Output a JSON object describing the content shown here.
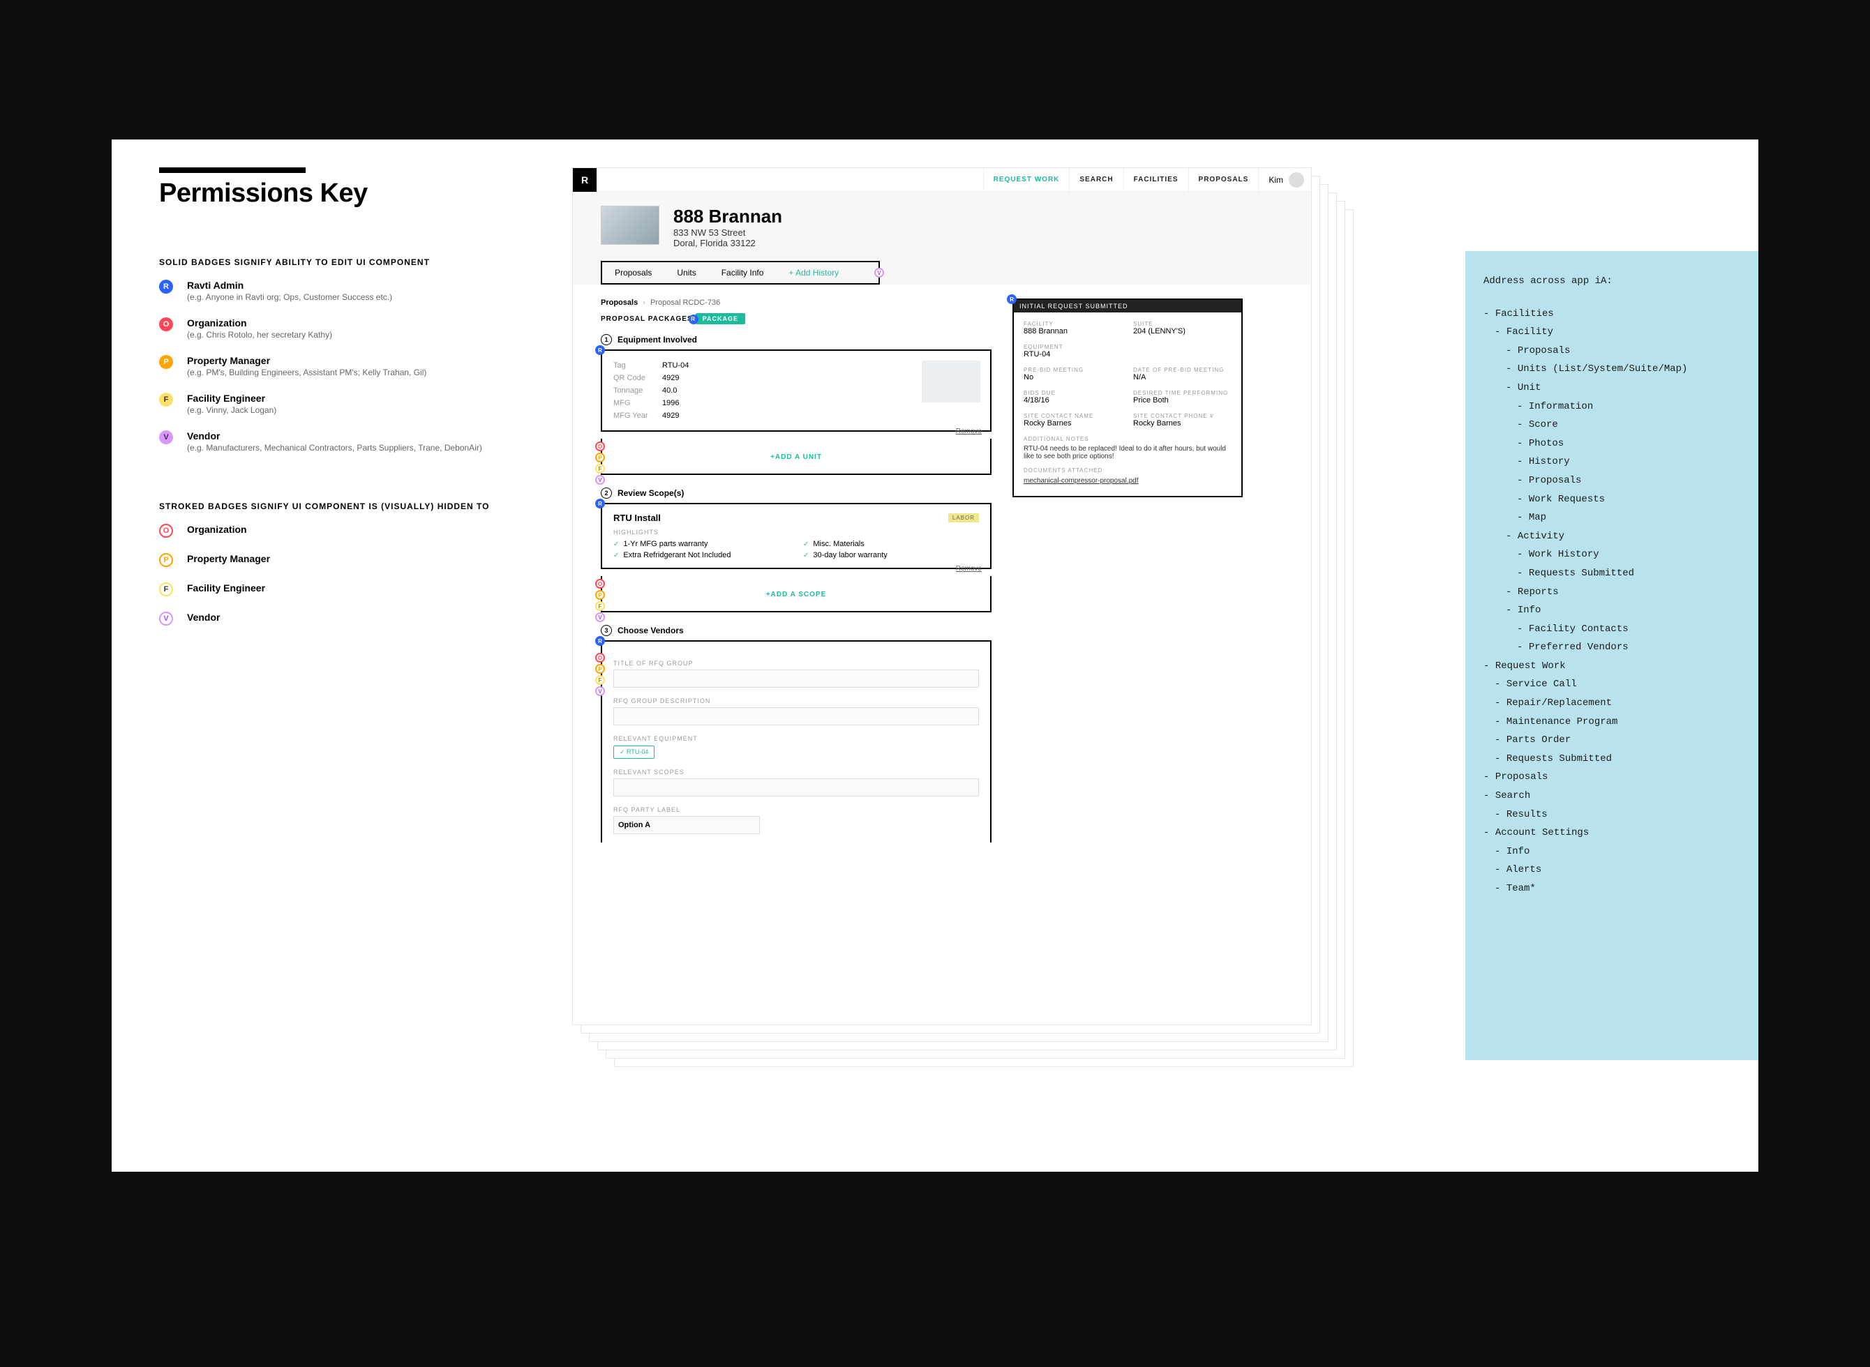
{
  "page_title": "Permissions Key",
  "solid_heading": "SOLID BADGES SIGNIFY ABILITY TO EDIT UI COMPONENT",
  "stroked_heading": "STROKED BADGES SIGNIFY UI COMPONENT IS (VISUALLY) HIDDEN TO",
  "badges_solid": [
    {
      "letter": "R",
      "cls": "r",
      "name": "Ravti Admin",
      "desc": "(e.g. Anyone in Ravti org; Ops, Customer Success etc.)"
    },
    {
      "letter": "O",
      "cls": "o",
      "name": "Organization",
      "desc": "(e.g. Chris Rotolo, her secretary Kathy)"
    },
    {
      "letter": "P",
      "cls": "p",
      "name": "Property Manager",
      "desc": "(e.g. PM's, Building Engineers, Assistant PM's; Kelly Trahan, Gil)"
    },
    {
      "letter": "F",
      "cls": "f",
      "name": "Facility Engineer",
      "desc": "(e.g. Vinny, Jack Logan)"
    },
    {
      "letter": "V",
      "cls": "v",
      "name": "Vendor",
      "desc": "(e.g. Manufacturers, Mechanical Contractors, Parts Suppliers, Trane, DebonAir)"
    }
  ],
  "badges_stroked": [
    {
      "letter": "O",
      "cls": "o",
      "name": "Organization"
    },
    {
      "letter": "P",
      "cls": "p",
      "name": "Property Manager"
    },
    {
      "letter": "F",
      "cls": "f",
      "name": "Facility Engineer"
    },
    {
      "letter": "V",
      "cls": "v",
      "name": "Vendor"
    }
  ],
  "nav": {
    "request_work": "REQUEST WORK",
    "search": "SEARCH",
    "facilities": "FACILITIES",
    "proposals": "PROPOSALS",
    "user": "Kim"
  },
  "site": {
    "name": "888 Brannan",
    "addr1": "833 NW 53 Street",
    "addr2": "Doral, Florida 33122",
    "tabs": {
      "proposals": "Proposals",
      "units": "Units",
      "facility_info": "Facility Info",
      "add_history": "+ Add History"
    }
  },
  "breadcrumb": {
    "root": "Proposals",
    "current": "Proposal RCDC-736"
  },
  "package_label": "PROPOSAL PACKAGES",
  "package_badge": "PACKAGE",
  "steps": {
    "s1": {
      "num": "1",
      "title": "Equipment Involved"
    },
    "s2": {
      "num": "2",
      "title": "Review Scope(s)"
    },
    "s3": {
      "num": "3",
      "title": "Choose Vendors"
    }
  },
  "equipment": [
    {
      "label": "Tag",
      "val": "RTU-04"
    },
    {
      "label": "QR Code",
      "val": "4929"
    },
    {
      "label": "Tonnage",
      "val": "40.0"
    },
    {
      "label": "MFG",
      "val": "1996"
    },
    {
      "label": "MFG Year",
      "val": "4929"
    }
  ],
  "add_unit": "+ADD A UNIT",
  "add_scope": "+ADD A SCOPE",
  "remove": "Remove",
  "scope": {
    "title": "RTU Install",
    "tag": "LABOR",
    "highlights_label": "HIGHLIGHTS",
    "highlights": [
      "1-Yr MFG parts warranty",
      "Misc. Materials",
      "Extra Refridgerant Not Included",
      "30-day labor warranty"
    ]
  },
  "vendor_form": {
    "title_label": "TITLE OF RFQ GROUP",
    "desc_label": "RFQ GROUP DESCRIPTION",
    "eq_label": "RELEVANT EQUIPMENT",
    "eq_chip": "RTU-04",
    "scopes_label": "RELEVANT SCOPES",
    "party_label": "RFQ PARTY LABEL",
    "party_val": "Option A"
  },
  "request_card": {
    "title": "INITIAL REQUEST SUBMITTED",
    "facility_lbl": "FACILITY",
    "facility_val": "888 Brannan",
    "suite_lbl": "SUITE",
    "suite_val": "204 (LENNY'S)",
    "equipment_lbl": "EQUIPMENT",
    "equipment_val": "RTU-04",
    "prebid_lbl": "PRE-BID MEETING",
    "prebid_val": "No",
    "prebid_date_lbl": "DATE OF PRE-BID MEETING",
    "prebid_date_val": "N/A",
    "bids_due_lbl": "BIDS DUE",
    "bids_due_val": "4/18/16",
    "desired_lbl": "DESIRED TIME PERFORMING",
    "desired_val": "Price Both",
    "contact_name_lbl": "SITE CONTACT NAME",
    "contact_name_val": "Rocky Barnes",
    "contact_phone_lbl": "SITE CONTACT PHONE #",
    "contact_phone_val": "Rocky Barnes",
    "notes_lbl": "ADDITIONAL NOTES",
    "notes_val": "RTU-04 needs to be replaced! Ideal to do it after hours, but would like to see both price options!",
    "docs_lbl": "DOCUMENTS ATTACHED",
    "doc_link": "mechanical-compressor-proposal.pdf"
  },
  "ia": {
    "title": "Address across app iA:",
    "tree": [
      {
        "t": "Facilities",
        "i": 0
      },
      {
        "t": "Facility",
        "i": 1
      },
      {
        "t": "Proposals",
        "i": 2
      },
      {
        "t": "Units (List/System/Suite/Map)",
        "i": 2
      },
      {
        "t": "Unit",
        "i": 2
      },
      {
        "t": "Information",
        "i": 3
      },
      {
        "t": "Score",
        "i": 3
      },
      {
        "t": "Photos",
        "i": 3
      },
      {
        "t": "History",
        "i": 3
      },
      {
        "t": "Proposals",
        "i": 3
      },
      {
        "t": "Work Requests",
        "i": 3
      },
      {
        "t": "Map",
        "i": 3
      },
      {
        "t": "Activity",
        "i": 2
      },
      {
        "t": "Work History",
        "i": 3
      },
      {
        "t": "Requests Submitted",
        "i": 3
      },
      {
        "t": "Reports",
        "i": 2
      },
      {
        "t": "Info",
        "i": 2
      },
      {
        "t": "Facility Contacts",
        "i": 3
      },
      {
        "t": "Preferred Vendors",
        "i": 3
      },
      {
        "t": "Request Work",
        "i": 0
      },
      {
        "t": "Service Call",
        "i": 1
      },
      {
        "t": "Repair/Replacement",
        "i": 1
      },
      {
        "t": "Maintenance Program",
        "i": 1
      },
      {
        "t": "Parts Order",
        "i": 1
      },
      {
        "t": "Requests Submitted",
        "i": 1
      },
      {
        "t": "Proposals",
        "i": 0
      },
      {
        "t": "Search",
        "i": 0
      },
      {
        "t": "Results",
        "i": 1
      },
      {
        "t": "Account Settings",
        "i": 0
      },
      {
        "t": "Info",
        "i": 1
      },
      {
        "t": "Alerts",
        "i": 1
      },
      {
        "t": "Team*",
        "i": 1
      }
    ]
  }
}
